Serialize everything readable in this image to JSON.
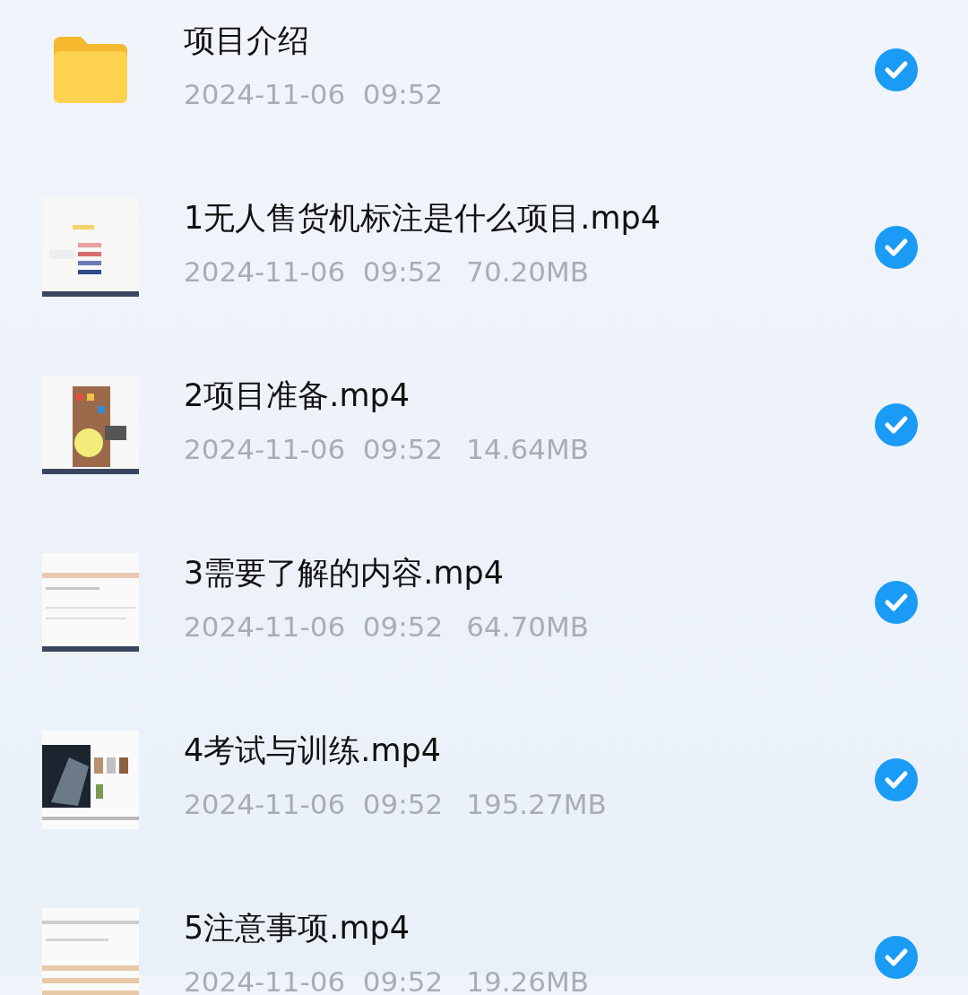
{
  "files": [
    {
      "kind": "folder",
      "name": "项目介绍",
      "date": "2024-11-06  09:52",
      "checked": true
    },
    {
      "kind": "video",
      "name": "1无人售货机标注是什么项目.mp4",
      "date": "2024-11-06  09:52",
      "size": "70.20MB",
      "checked": true
    },
    {
      "kind": "video",
      "name": "2项目准备.mp4",
      "date": "2024-11-06  09:52",
      "size": "14.64MB",
      "checked": true
    },
    {
      "kind": "video",
      "name": "3需要了解的内容.mp4",
      "date": "2024-11-06  09:52",
      "size": "64.70MB",
      "checked": true
    },
    {
      "kind": "video",
      "name": "4考试与训练.mp4",
      "date": "2024-11-06  09:52",
      "size": "195.27MB",
      "checked": true
    },
    {
      "kind": "video",
      "name": "5注意事项.mp4",
      "date": "2024-11-06  09:52",
      "size": "19.26MB",
      "checked": true
    }
  ]
}
